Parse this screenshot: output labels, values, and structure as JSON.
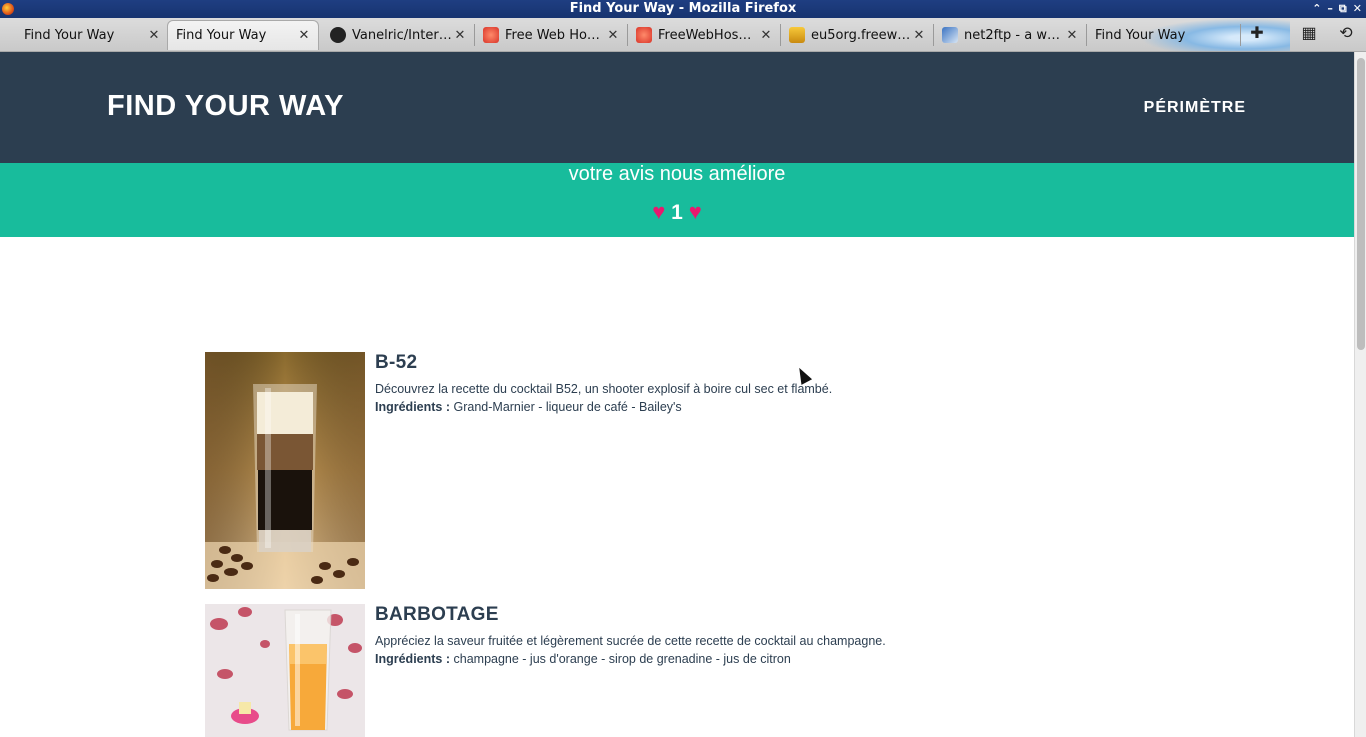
{
  "window": {
    "title": "Find Your Way - Mozilla Firefox"
  },
  "tabs": [
    {
      "label": "Find Your Way",
      "favicon": "none"
    },
    {
      "label": "Find Your Way",
      "favicon": "none",
      "active": true
    },
    {
      "label": "Vanelric/Inter…",
      "favicon": "github-icon"
    },
    {
      "label": "Free Web Ho…",
      "favicon": "freewebhosting-icon"
    },
    {
      "label": "FreeWebHos…",
      "favicon": "freewebhosting-icon"
    },
    {
      "label": "eu5org.freew…",
      "favicon": "eu5-icon"
    },
    {
      "label": "net2ftp - a w…",
      "favicon": "net2ftp-icon"
    },
    {
      "label": "Find Your Way",
      "favicon": "none"
    }
  ],
  "header": {
    "brand": "FIND YOUR WAY",
    "nav_link": "PÉRIMÈTRE"
  },
  "banner": {
    "tagline": "votre avis nous améliore",
    "count": "1",
    "heart_color": "#e8196e"
  },
  "colors": {
    "header_bg": "#2c3e50",
    "banner_bg": "#18bc9c"
  },
  "recipes": [
    {
      "title": "B-52",
      "description": "Découvrez la recette du cocktail B52, un shooter explosif à boire cul sec et flambé.",
      "ingredients_label": "Ingrédients :",
      "ingredients": "Grand-Marnier - liqueur de café - Bailey's"
    },
    {
      "title": "BARBOTAGE",
      "description": "Appréciez la saveur fruitée et légèrement sucrée de cette recette de cocktail au champagne.",
      "ingredients_label": "Ingrédients :",
      "ingredients": "champagne - jus d'orange - sirop de grenadine - jus de citron"
    }
  ]
}
